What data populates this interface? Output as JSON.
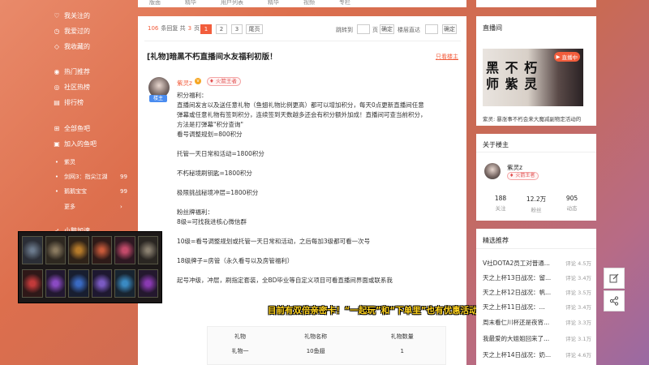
{
  "topnav": [
    "版面",
    "精华",
    "用户列表",
    "精华",
    "视频",
    "专栏"
  ],
  "sidebar": {
    "items": [
      {
        "icon": "heart-icon",
        "label": "我关注的"
      },
      {
        "icon": "history-icon",
        "label": "我爱过的"
      },
      {
        "icon": "fish-icon",
        "label": "我收藏的"
      },
      {
        "icon": "fire-icon",
        "label": "热门推荐"
      },
      {
        "icon": "community-icon",
        "label": "社区热榜"
      },
      {
        "icon": "rank-icon",
        "label": "排行榜"
      },
      {
        "icon": "grid-icon",
        "label": "全部鱼吧"
      },
      {
        "icon": "group-icon",
        "label": "加入的鱼吧"
      }
    ],
    "joined": [
      {
        "label": "紫灵",
        "count": ""
      },
      {
        "label": "剑网3：指尖江湖",
        "count": "99"
      },
      {
        "label": "鹅鹅宝宝",
        "count": "99"
      }
    ],
    "more": "更多",
    "bottom": "小鹅加速"
  },
  "pagination": {
    "replies": "106",
    "replies_suffix": "条回复 共",
    "pages": "3",
    "pages_suffix": "页",
    "buttons": [
      "1",
      "2",
      "3",
      "尾页"
    ],
    "jump_label": "跳转到",
    "page_unit": "页",
    "confirm": "确定",
    "floor_label": "楼层直达",
    "floor_confirm": "确定"
  },
  "post": {
    "title": "[礼物]暗黑不朽直播间水友福利初版！",
    "only_op": "只看楼主",
    "author": "紫灵z",
    "level_badge": "火箭王者",
    "avatar_tag": "楼主",
    "lines": [
      "积分福利：",
      "直播间发言以及送任意礼物（鱼翅礼物比例更高）都可以增加积分，每天0点更新直播间任意",
      "弹幕或任意礼物有签到积分，连续签到天数越多还会有积分额外加成！直播间可查当前积分，",
      "方法是打弹幕\"积分查询\"",
      "看号调整规划=800积分",
      "",
      "托管一天日常和活动=1800积分",
      "",
      "不朽秘境刷钥匙=1800积分",
      "",
      "极限挑战秘境冲层=1800积分",
      "",
      "粉丝牌福利：",
      "8级=可找我进核心微信群",
      "",
      "10级=看号调整规划或托管一天日常和活动，之后每加3级都可看一次号",
      "",
      "18级牌子=房管（永久看号以及房管福利）",
      "",
      "起号冲级，冲层，刷指定套装，全BD毕业等自定义项目可看直播间界面或联系我"
    ],
    "table": {
      "headers": [
        "礼物",
        "礼物名称",
        "礼物数量"
      ],
      "rows": [
        [
          "礼物一",
          "10鱼翅",
          "1"
        ]
      ]
    }
  },
  "banner": "目前有双倍亲密卡！“一起玩”和“下单里”也有优惠活动！",
  "right": {
    "live_title": "直播间",
    "live_badge": "直播中",
    "live_thumb_text": "黑 不 朽  师 紫 灵",
    "live_caption": "紫灵: 暴涨事不朽会来大魔减副物定活动的",
    "owner_title": "关于楼主",
    "owner_name": "紫灵z",
    "owner_badge": "火箭王者",
    "stats": [
      {
        "value": "188",
        "label": "关注"
      },
      {
        "value": "12.2万",
        "label": "粉丝"
      },
      {
        "value": "905",
        "label": "动态"
      }
    ],
    "hot_title": "精选推荐",
    "hot": [
      {
        "title": "V社DOTA2员工对普通...",
        "count": "评论 4.5万"
      },
      {
        "title": "天之上杯13日战况：留...",
        "count": "评论 3.4万"
      },
      {
        "title": "天之上杯12日战况：帆...",
        "count": "评论 3.5万"
      },
      {
        "title": "天之上杯11日战况：...",
        "count": "评论 3.4万"
      },
      {
        "title": "周末看仁川杯还是夜宵...",
        "count": "评论 3.3万"
      },
      {
        "title": "我最爱的大姐姐回来了...",
        "count": "评论 3.1万"
      },
      {
        "title": "天之上杯14日战况：奶...",
        "count": "评论 4.6万"
      }
    ]
  },
  "colors": {
    "accent": "#f25d3c",
    "banner": "#ffd21f"
  }
}
